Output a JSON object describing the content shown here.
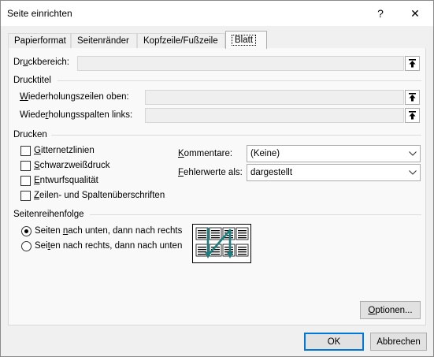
{
  "window": {
    "title": "Seite einrichten",
    "help_glyph": "?",
    "close_glyph": "✕"
  },
  "tabs": [
    {
      "label": "Papierformat",
      "active": false
    },
    {
      "label": "Seitenränder",
      "active": false
    },
    {
      "label": "Kopfzeile/Fußzeile",
      "active": false
    },
    {
      "label": "Blatt",
      "active": true
    }
  ],
  "print_area": {
    "label_pre": "Dr",
    "label_u": "u",
    "label_post": "ckbereich:",
    "value": ""
  },
  "print_titles": {
    "heading": "Drucktitel",
    "rows_label_pre": "",
    "rows_label_u": "W",
    "rows_label_post": "iederholungszeilen oben:",
    "cols_label_pre": "Wiede",
    "cols_label_u": "r",
    "cols_label_post": "holungsspalten links:"
  },
  "print": {
    "heading": "Drucken",
    "checkboxes": [
      {
        "u": "G",
        "rest": "itternetzlinien",
        "checked": false
      },
      {
        "u": "S",
        "rest": "chwarzweißdruck",
        "checked": false
      },
      {
        "u": "E",
        "rest": "ntwurfsqualität",
        "checked": false
      },
      {
        "u": "Z",
        "rest": "eilen- und Spaltenüberschriften",
        "checked": false
      }
    ],
    "comments_label_u": "K",
    "comments_label_rest": "ommentare:",
    "comments_value": "(Keine)",
    "errors_label_u": "F",
    "errors_label_rest": "ehlerwerte als:",
    "errors_value": "dargestellt"
  },
  "page_order": {
    "heading": "Seitenreihenfolge",
    "down_then_over": {
      "pre": "Seiten ",
      "u": "n",
      "post": "ach unten, dann nach rechts",
      "selected": true
    },
    "over_then_down": {
      "pre": "Sei",
      "u": "t",
      "post": "en nach rechts, dann nach unten",
      "selected": false
    }
  },
  "buttons": {
    "options_u": "O",
    "options_rest": "ptionen...",
    "ok": "OK",
    "cancel": "Abbrechen"
  },
  "colors": {
    "accent": "#0078d7",
    "preview_arrow": "#1a7f7f"
  }
}
